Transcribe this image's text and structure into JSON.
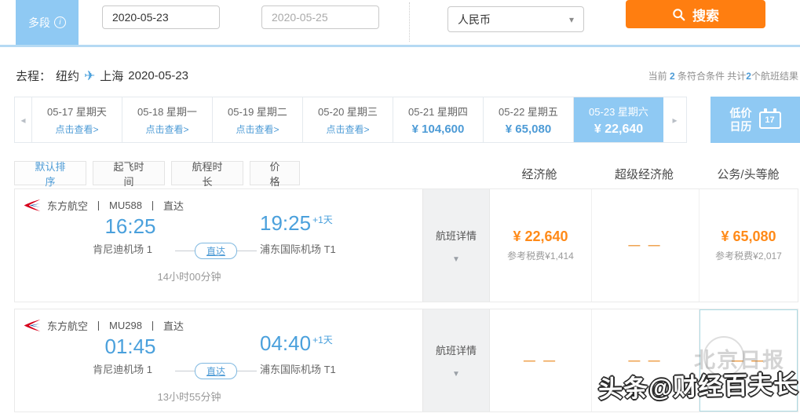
{
  "header": {
    "multi_tab_label": "多段",
    "info_icon": "i",
    "date_from_value": "2020-05-23",
    "date_to_placeholder": "2020-05-25",
    "currency_value": "人民币",
    "search_label": "搜索"
  },
  "route_bar": {
    "label": "去程：",
    "from": "纽约",
    "to": "上海",
    "date": "2020-05-23",
    "summary": {
      "t1": "当前 ",
      "n1": "2",
      "t2": " 条符合条件 共计",
      "n2": "2",
      "t3": "个航班结果"
    }
  },
  "date_tabs": [
    {
      "date": "05-17",
      "day": "星期天",
      "sub": "点击查看>"
    },
    {
      "date": "05-18",
      "day": "星期一",
      "sub": "点击查看>"
    },
    {
      "date": "05-19",
      "day": "星期二",
      "sub": "点击查看>"
    },
    {
      "date": "05-20",
      "day": "星期三",
      "sub": "点击查看>"
    },
    {
      "date": "05-21",
      "day": "星期四",
      "sub": "¥ 104,600"
    },
    {
      "date": "05-22",
      "day": "星期五",
      "sub": "¥ 65,080"
    },
    {
      "date": "05-23",
      "day": "星期六",
      "sub": "¥ 22,640",
      "selected": true
    }
  ],
  "low_price_calendar": {
    "line1": "低价",
    "line2": "日历",
    "icon_day": "17"
  },
  "filters": [
    "默认排序",
    "起飞时间",
    "航程时长",
    "价格"
  ],
  "columns": [
    "经济舱",
    "超级经济舱",
    "公务/头等舱"
  ],
  "labels": {
    "separator": "丨",
    "flight_details": "航班详情",
    "details_caret": "▼",
    "currency_caret": "▾",
    "arrow_left": "◂",
    "arrow_right": "▸",
    "plane_icon": "✈"
  },
  "flights": [
    {
      "airline": "东方航空",
      "flight_no": "MU588",
      "route_type": "直达",
      "dep_time": "16:25",
      "dep_airport": "肯尼迪机场 1",
      "stop_label": "直达",
      "arr_time": "19:25",
      "arr_plus": "+1天",
      "arr_airport": "浦东国际机场 T1",
      "duration": "14小时00分钟",
      "economy": {
        "price": "¥ 22,640",
        "tax": "参考税费¥1,414"
      },
      "premium": {
        "dash": "— —"
      },
      "business": {
        "price": "¥ 65,080",
        "tax": "参考税费¥2,017"
      }
    },
    {
      "airline": "东方航空",
      "flight_no": "MU298",
      "route_type": "直达",
      "dep_time": "01:45",
      "dep_airport": "肯尼迪机场 1",
      "stop_label": "直达",
      "arr_time": "04:40",
      "arr_plus": "+1天",
      "arr_airport": "浦东国际机场 T1",
      "duration": "13小时55分钟",
      "economy": {
        "dash": "— —"
      },
      "premium": {
        "dash": "— —"
      },
      "business": {
        "dash": "— —"
      }
    }
  ],
  "watermark": {
    "main": "头条@财经百夫长",
    "background_text": "北京日报"
  },
  "colors": {
    "accent_blue": "#8fc9f3",
    "link_blue": "#4d9bd6",
    "time_blue": "#4aa0dc",
    "button_orange": "#ff7e10",
    "price_orange": "#ff8a18",
    "highlight_teal": "#aedbe4"
  }
}
